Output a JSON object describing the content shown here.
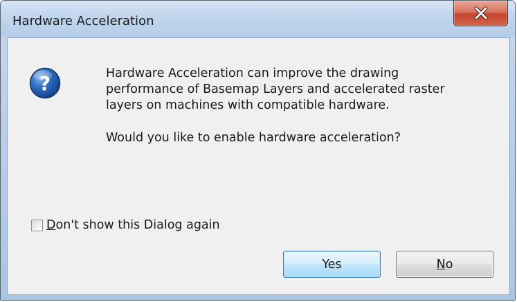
{
  "window": {
    "title": "Hardware Acceleration"
  },
  "message": {
    "line1": "Hardware Acceleration can improve the drawing",
    "line2": "performance of Basemap Layers and accelerated raster",
    "line3": "layers on machines with compatible hardware.",
    "question": "Would you like to enable hardware acceleration?"
  },
  "checkbox": {
    "label_accel": "D",
    "label_rest": "on't show this Dialog again",
    "checked": false
  },
  "buttons": {
    "yes_label": "Yes",
    "no_accel": "N",
    "no_rest": "o"
  },
  "icons": {
    "dialog_icon": "question-icon",
    "close_icon": "close-icon"
  },
  "colors": {
    "close_red": "#c5442d",
    "icon_blue": "#1f5fb0",
    "default_button_border": "#3c7fb1"
  }
}
